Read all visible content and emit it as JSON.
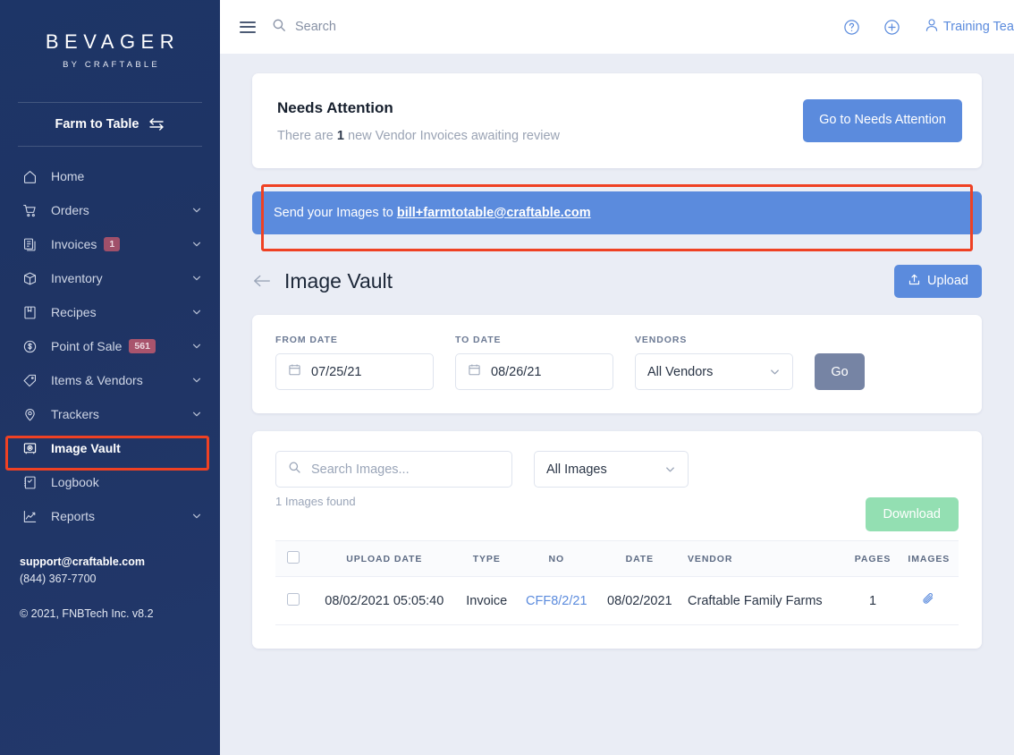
{
  "sidebar": {
    "brand": {
      "name": "BEVAGER",
      "tagline": "BY CRAFTABLE"
    },
    "org": {
      "label": "Farm to Table",
      "swap_icon": "swap-horizontal-icon"
    },
    "items": [
      {
        "label": "Home",
        "icon": "home-icon",
        "badge": null,
        "chevron": false,
        "active": false
      },
      {
        "label": "Orders",
        "icon": "cart-icon",
        "badge": null,
        "chevron": true,
        "active": false
      },
      {
        "label": "Invoices",
        "icon": "documents-icon",
        "badge": "1",
        "chevron": true,
        "active": false
      },
      {
        "label": "Inventory",
        "icon": "box-icon",
        "badge": null,
        "chevron": true,
        "active": false
      },
      {
        "label": "Recipes",
        "icon": "book-icon",
        "badge": null,
        "chevron": true,
        "active": false
      },
      {
        "label": "Point of Sale",
        "icon": "dollar-circle-icon",
        "badge": "561",
        "chevron": true,
        "active": false
      },
      {
        "label": "Items & Vendors",
        "icon": "tag-icon",
        "badge": null,
        "chevron": true,
        "active": false
      },
      {
        "label": "Trackers",
        "icon": "map-pin-icon",
        "badge": null,
        "chevron": true,
        "active": false
      },
      {
        "label": "Image Vault",
        "icon": "vault-icon",
        "badge": null,
        "chevron": false,
        "active": true
      },
      {
        "label": "Logbook",
        "icon": "notebook-icon",
        "badge": null,
        "chevron": false,
        "active": false
      },
      {
        "label": "Reports",
        "icon": "chart-line-icon",
        "badge": null,
        "chevron": true,
        "active": false
      }
    ],
    "footer": {
      "email": "support@craftable.com",
      "phone": "(844) 367-7700",
      "copyright": "© 2021, FNBTech Inc. v8.2"
    }
  },
  "topbar": {
    "menu_icon": "hamburger-icon",
    "search_icon": "search-icon",
    "search_placeholder": "Search",
    "help_icon": "help-circle-icon",
    "add_icon": "plus-circle-icon",
    "user_icon": "user-icon",
    "user_name": "Training Team"
  },
  "needs_attention": {
    "title": "Needs Attention",
    "message_prefix": "There are",
    "count": "1",
    "message_suffix": "new Vendor Invoices awaiting review",
    "button_label": "Go to Needs Attention"
  },
  "email_banner": {
    "text": "Send your Images to",
    "email": "bill+farmtotable@craftable.com"
  },
  "page": {
    "back_icon": "arrow-left-icon",
    "title": "Image Vault",
    "upload_label": "Upload",
    "upload_icon": "upload-icon"
  },
  "filters": {
    "from_date_label": "FROM DATE",
    "from_date_value": "07/25/21",
    "to_date_label": "TO DATE",
    "to_date_value": "08/26/21",
    "vendors_label": "VENDORS",
    "vendors_value": "All Vendors",
    "calendar_icon": "calendar-icon",
    "chevron_icon": "chevron-down-icon",
    "go_label": "Go"
  },
  "image_search": {
    "search_icon": "search-icon",
    "placeholder": "Search Images...",
    "type_filter_value": "All Images",
    "results_text": "1 Images found",
    "download_label": "Download"
  },
  "table": {
    "columns": [
      "",
      "UPLOAD DATE",
      "TYPE",
      "NO",
      "DATE",
      "VENDOR",
      "PAGES",
      "IMAGES"
    ],
    "rows": [
      {
        "upload_date": "08/02/2021 05:05:40",
        "type": "Invoice",
        "no": "CFF8/2/21",
        "date": "08/02/2021",
        "vendor": "Craftable Family Farms",
        "pages": "1",
        "images_icon": "paperclip-icon"
      }
    ]
  },
  "colors": {
    "sidebar_bg": "#1f3464",
    "accent_blue": "#5b8bdd",
    "highlight_red": "#ef4123",
    "download_green": "#93dfb2",
    "go_gray": "#7684a4",
    "badge_red": "#a0506a",
    "page_bg": "#eaedf5"
  }
}
